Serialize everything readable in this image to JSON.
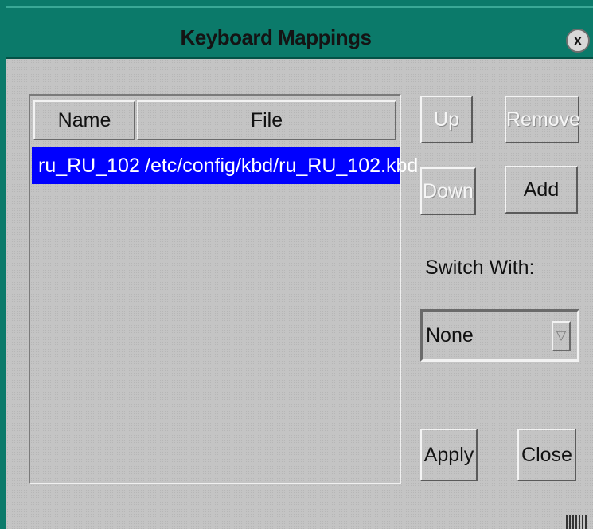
{
  "window": {
    "title": "Keyboard Mappings",
    "close_glyph": "x",
    "close_icon": "close-icon"
  },
  "table": {
    "columns": [
      "Name",
      "File"
    ],
    "rows": [
      {
        "name": "ru_RU_102",
        "file": "/etc/config/kbd/ru_RU_102.kbd",
        "selected": true
      }
    ]
  },
  "buttons": {
    "up": {
      "label": "Up",
      "enabled": false
    },
    "remove": {
      "label": "Remove",
      "enabled": false
    },
    "down": {
      "label": "Down",
      "enabled": false
    },
    "add": {
      "label": "Add",
      "enabled": true
    },
    "apply": {
      "label": "Apply",
      "enabled": true
    },
    "close": {
      "label": "Close",
      "enabled": true
    }
  },
  "switch_with": {
    "label": "Switch With:",
    "value": "None",
    "dropdown_icon": "triangle-down-icon"
  },
  "colors": {
    "titlebar": "#0b7a6a",
    "selection": "#0000ff",
    "panel": "#c4c4c4"
  }
}
